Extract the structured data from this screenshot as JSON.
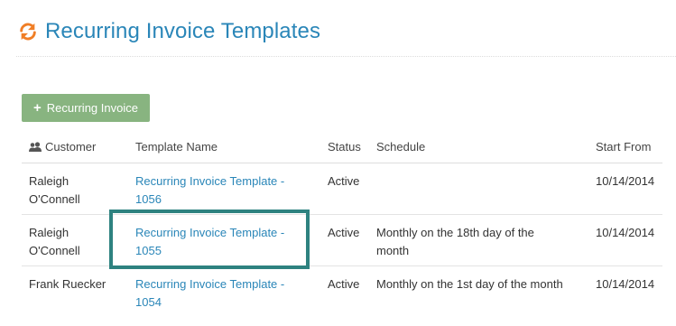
{
  "header": {
    "title": "Recurring Invoice Templates",
    "icon": "refresh-icon",
    "icon_color": "#f07e26",
    "title_color": "#2a86b8"
  },
  "toolbar": {
    "add_label": "Recurring Invoice",
    "add_color": "#88b480"
  },
  "table": {
    "columns": {
      "customer": "Customer",
      "template": "Template Name",
      "status": "Status",
      "schedule": "Schedule",
      "start": "Start From"
    },
    "rows": [
      {
        "customer_line1": "Raleigh",
        "customer_line2": "O'Connell",
        "template_line1": "Recurring Invoice Template -",
        "template_line2": "1056",
        "status": "Active",
        "schedule_line1": "",
        "schedule_line2": "",
        "start": "10/14/2014"
      },
      {
        "customer_line1": "Raleigh",
        "customer_line2": "O'Connell",
        "template_line1": "Recurring Invoice Template -",
        "template_line2": "1055",
        "status": "Active",
        "schedule_line1": "Monthly on the 18th day of the",
        "schedule_line2": "month",
        "start": "10/14/2014"
      },
      {
        "customer_line1": "Frank Ruecker",
        "customer_line2": "",
        "template_line1": "Recurring Invoice Template -",
        "template_line2": "1054",
        "status": "Active",
        "schedule_line1": "Monthly on the 1st day of the month",
        "schedule_line2": "",
        "start": "10/14/2014"
      }
    ]
  },
  "highlight_color": "#2e8280"
}
